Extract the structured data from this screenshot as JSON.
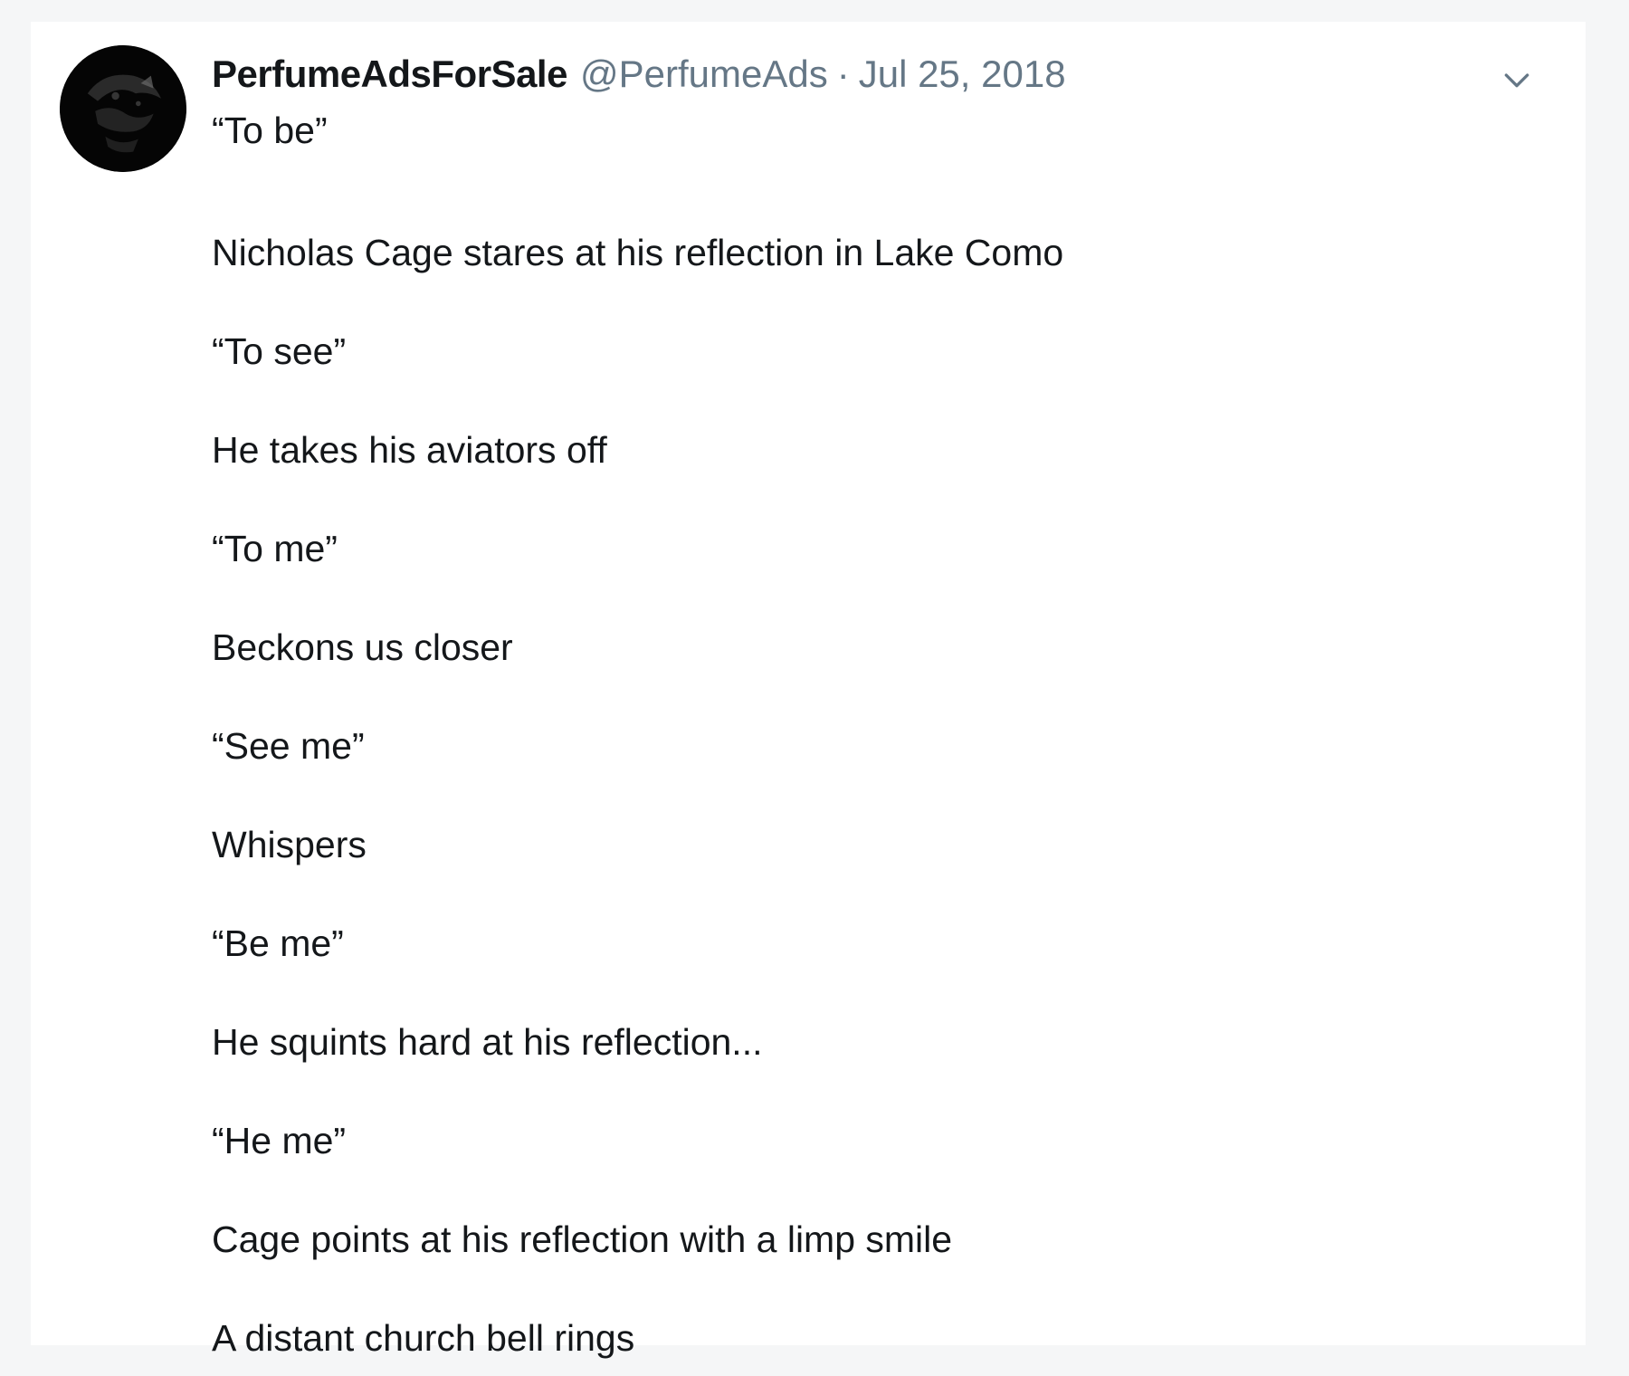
{
  "tweet": {
    "display_name": "PerfumeAdsForSale",
    "handle": "@PerfumeAds",
    "separator": "·",
    "date": "Jul 25, 2018",
    "avatar_icon": "avatar-image",
    "menu_icon": "chevron-down-icon",
    "lines": [
      "“To be”",
      "Nicholas Cage stares at his reflection in Lake Como",
      "“To see”",
      "He takes his aviators off",
      "“To me”",
      "Beckons us closer",
      "“See me”",
      "Whispers",
      "“Be me”",
      "He squints hard at his reflection...",
      "“He me”",
      "Cage points at his reflection with a limp smile",
      "A distant church bell rings"
    ]
  },
  "colors": {
    "page_background": "#f5f6f7",
    "card_background": "#ffffff",
    "text_primary": "#14171a",
    "text_secondary": "#657786"
  }
}
